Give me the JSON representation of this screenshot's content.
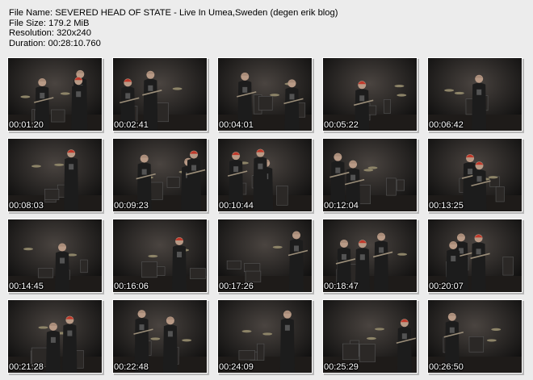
{
  "info": {
    "file_name": "File Name: SEVERED  HEAD OF STATE - Live In Umea,Sweden (degen erik blog)",
    "file_size": "File Size: 179.2 MiB",
    "resolution": "Resolution: 320x240",
    "duration": "Duration: 00:28:10.760"
  },
  "thumbnails": [
    {
      "timestamp": "00:01:20"
    },
    {
      "timestamp": "00:02:41"
    },
    {
      "timestamp": "00:04:01"
    },
    {
      "timestamp": "00:05:22"
    },
    {
      "timestamp": "00:06:42"
    },
    {
      "timestamp": "00:08:03"
    },
    {
      "timestamp": "00:09:23"
    },
    {
      "timestamp": "00:10:44"
    },
    {
      "timestamp": "00:12:04"
    },
    {
      "timestamp": "00:13:25"
    },
    {
      "timestamp": "00:14:45"
    },
    {
      "timestamp": "00:16:06"
    },
    {
      "timestamp": "00:17:26"
    },
    {
      "timestamp": "00:18:47"
    },
    {
      "timestamp": "00:20:07"
    },
    {
      "timestamp": "00:21:28"
    },
    {
      "timestamp": "00:22:48"
    },
    {
      "timestamp": "00:24:09"
    },
    {
      "timestamp": "00:25:29"
    },
    {
      "timestamp": "00:26:50"
    }
  ]
}
